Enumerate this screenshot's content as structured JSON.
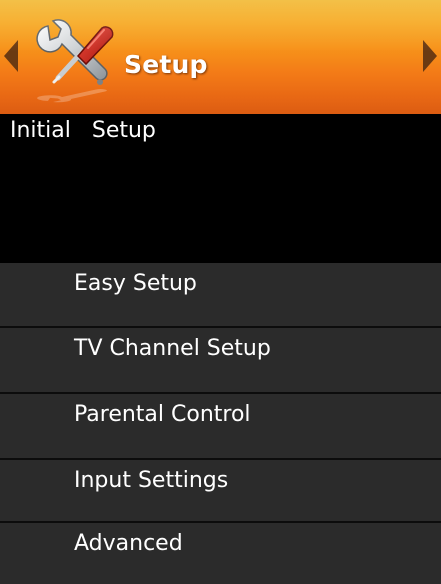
{
  "header": {
    "title": "Setup",
    "icon": "tools-icon"
  },
  "subtitle": "Initial   Setup",
  "menu": {
    "items": [
      {
        "label": "Easy Setup"
      },
      {
        "label": "TV Channel Setup"
      },
      {
        "label": "Parental Control"
      },
      {
        "label": "Input Settings"
      },
      {
        "label": "Advanced"
      }
    ]
  },
  "colors": {
    "header_gradient_top": "#f1b21f",
    "header_gradient_bottom": "#dc5c12",
    "panel_background": "#000000",
    "menu_background": "#2b2b2b",
    "text": "#ffffff",
    "arrow": "#6b3a12"
  }
}
